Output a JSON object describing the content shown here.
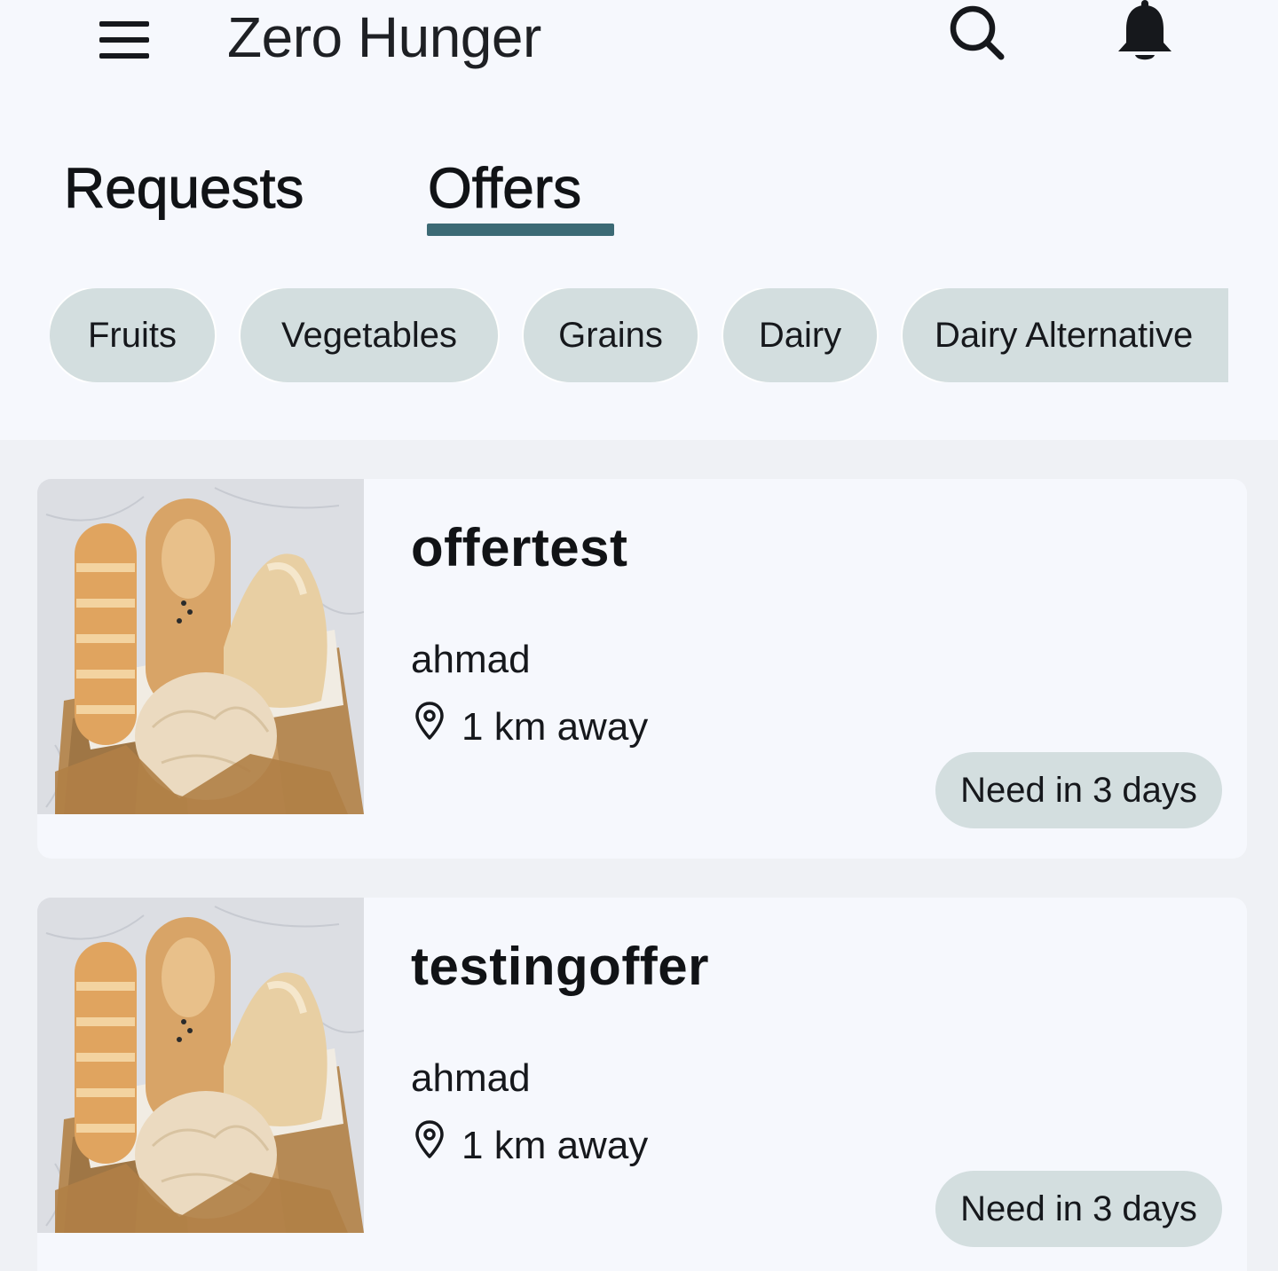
{
  "app": {
    "title": "Zero Hunger"
  },
  "header": {
    "menu_icon": "hamburger-menu-icon",
    "search_icon": "search-icon",
    "notification_icon": "bell-icon"
  },
  "tabs": [
    {
      "label": "Requests",
      "selected": false
    },
    {
      "label": "Offers",
      "selected": true
    }
  ],
  "colors": {
    "accent": "#3c6a75",
    "chip_bg": "#d3dedf",
    "page_bg": "#f6f8fd",
    "feed_bg": "#eff1f5"
  },
  "categories": [
    {
      "label": "Fruits"
    },
    {
      "label": "Vegetables"
    },
    {
      "label": "Grains"
    },
    {
      "label": "Dairy"
    },
    {
      "label": "Dairy Alternative"
    }
  ],
  "offers": [
    {
      "title": "offertest",
      "user": "ahmad",
      "distance": "1 km away",
      "need": "Need in 3 days",
      "location_icon": "map-pin-icon"
    },
    {
      "title": "testingoffer",
      "user": "ahmad",
      "distance": "1 km away",
      "need": "Need in 3 days",
      "location_icon": "map-pin-icon"
    }
  ]
}
